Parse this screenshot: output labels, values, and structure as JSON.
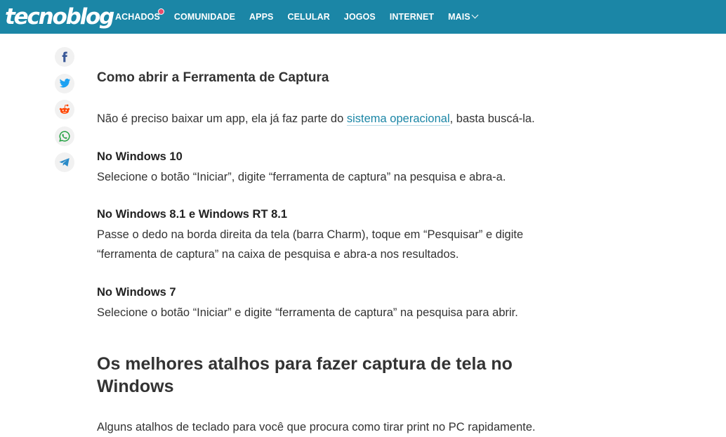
{
  "header": {
    "logo": "tecnoblog",
    "nav": [
      {
        "label": "ACHADOS",
        "badge": true
      },
      {
        "label": "COMUNIDADE"
      },
      {
        "label": "APPS"
      },
      {
        "label": "CELULAR"
      },
      {
        "label": "JOGOS"
      },
      {
        "label": "INTERNET"
      },
      {
        "label": "MAIS"
      }
    ],
    "brand_color": "#1b86a6"
  },
  "share": [
    "facebook-icon",
    "twitter-icon",
    "reddit-icon",
    "whatsapp-icon",
    "telegram-icon"
  ],
  "article": {
    "section_title": "Como abrir a Ferramenta de Captura",
    "intro_before": "Não é preciso baixar um app, ela já faz parte do ",
    "intro_link": "sistema operacional",
    "intro_after": ", basta buscá-la.",
    "win10_title": "No Windows 10",
    "win10_text": "Selecione o botão “Iniciar”, digite “ferramenta de captura” na pesquisa e abra-a.",
    "win81_title": "No Windows 8.1 e Windows RT 8.1",
    "win81_line1": "Passe o dedo na borda direita da tela (barra Charm), toque em “Pesquisar” e digite",
    "win81_line2": "“ferramenta de captura” na caixa de pesquisa e abra-a nos resultados.",
    "win7_title": "No Windows 7",
    "win7_text": "Selecione o botão “Iniciar” e digite “ferramenta de captura” na pesquisa para abrir.",
    "h2_line1": "Os melhores atalhos para fazer captura de tela no",
    "h2_line2": "Windows",
    "shortcuts_intro": "Alguns atalhos de teclado para você que procura como tirar print no PC rapidamente."
  }
}
